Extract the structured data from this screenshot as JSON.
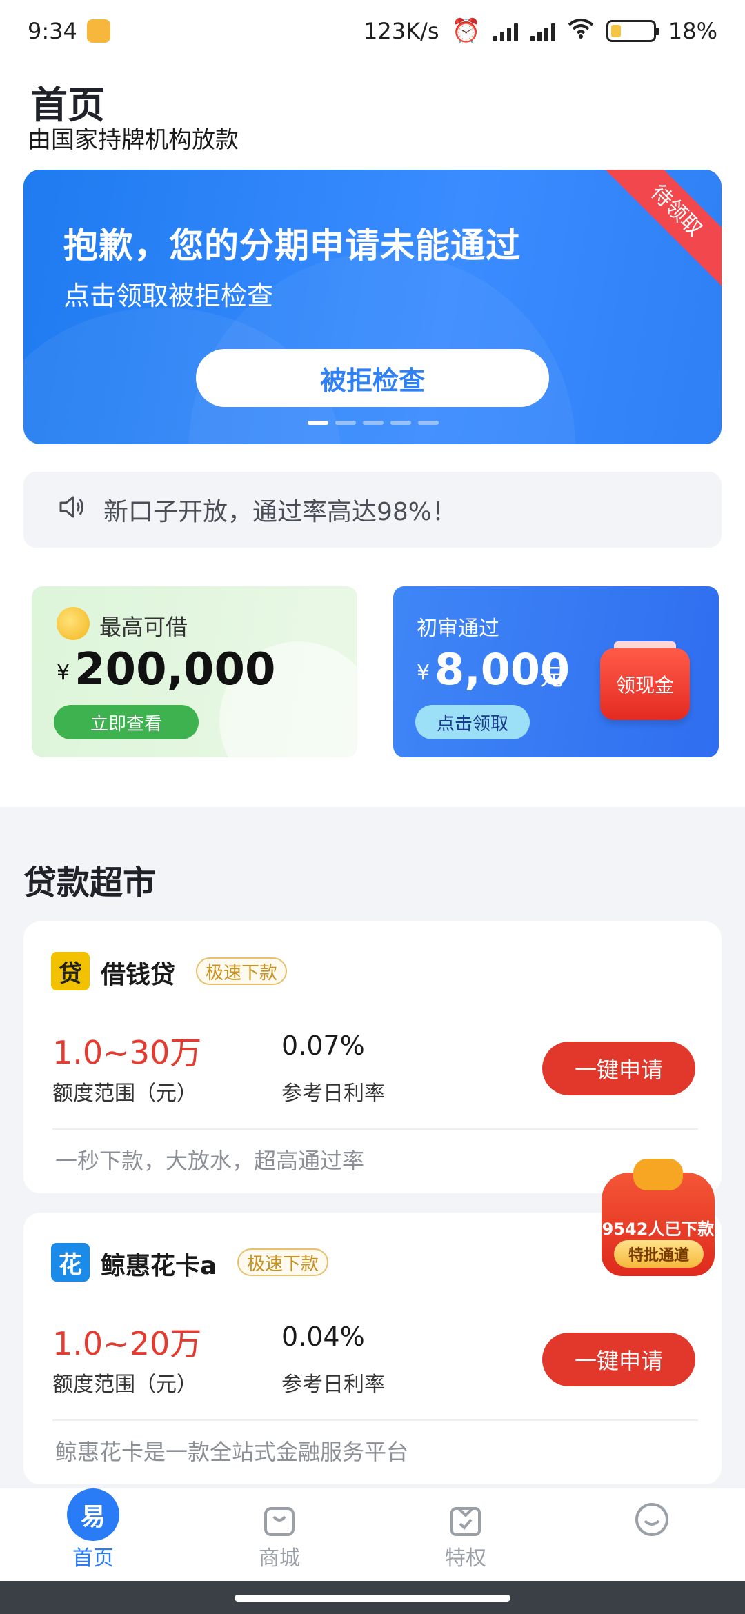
{
  "status_bar": {
    "time": "9:34",
    "speed": "123K/s",
    "battery": "18%"
  },
  "header": {
    "title": "首页",
    "subtitle": "由国家持牌机构放款"
  },
  "banner": {
    "ribbon": "待领取",
    "headline": "抱歉，您的分期申请未能通过",
    "sub": "点击领取被拒检查",
    "button": "被拒检查"
  },
  "notice": {
    "text": "新口子开放，通过率高达98%！",
    "icon": "speaker-icon"
  },
  "promo_left": {
    "label": "最高可借",
    "currency": "¥",
    "amount": "200,000",
    "button": "立即查看"
  },
  "promo_right": {
    "label": "初审通过",
    "currency": "¥",
    "amount": "8,000",
    "unit": "元",
    "button": "点击领取",
    "envelope": "领现金"
  },
  "section": {
    "title": "贷款超市"
  },
  "loans": [
    {
      "name": "借钱贷",
      "tag": "极速下款",
      "amount": "1.0~30万",
      "amount_label": "额度范围（元）",
      "rate": "0.07%",
      "rate_label": "参考日利率",
      "button": "一键申请",
      "desc": "一秒下款，大放水，超高通过率",
      "logo_color": "#f2c200",
      "logo_char": "贷"
    },
    {
      "name": "鲸惠花卡a",
      "tag": "极速下款",
      "amount": "1.0~20万",
      "amount_label": "额度范围（元）",
      "rate": "0.04%",
      "rate_label": "参考日利率",
      "button": "一键申请",
      "desc": "鲸惠花卡是一款全站式金融服务平台",
      "logo_color": "#1a8be8",
      "logo_char": "花"
    }
  ],
  "float_promo": {
    "count": "9542人已下款",
    "button": "特批通道"
  },
  "nav": [
    {
      "label": "首页",
      "icon": "home-icon",
      "active": true
    },
    {
      "label": "商城",
      "icon": "shopping-bag-icon",
      "active": false
    },
    {
      "label": "特权",
      "icon": "privilege-icon",
      "active": false
    },
    {
      "label": "",
      "icon": "smile-icon",
      "active": false
    }
  ],
  "colors": {
    "primary": "#2a7cf6",
    "danger": "#e2372b"
  }
}
